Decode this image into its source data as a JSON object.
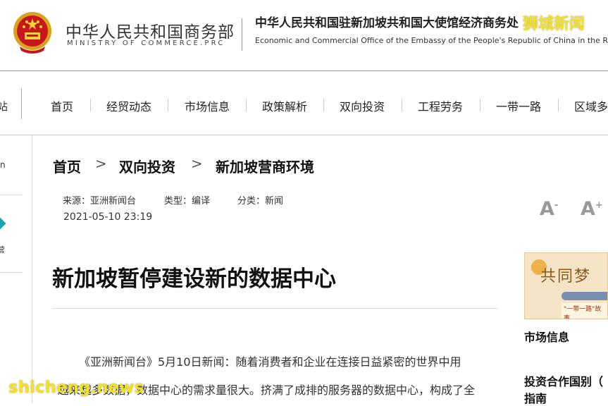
{
  "header": {
    "ministry_cn": "中华人民共和国商务部",
    "ministry_en": "MINISTRY OF COMMERCE.PRC",
    "office_cn": "中华人民共和国驻新加坡共和国大使馆经济商务处",
    "office_en": "Economic and Commercial Office of the Embassy of the People's Republic of China in the Rep",
    "watermark": "狮城新闻"
  },
  "nav": {
    "cut_item": "站",
    "items": [
      "首页",
      "经贸动态",
      "市场信息",
      "政策解析",
      "双向投资",
      "工程劳务",
      "一带一路",
      "区域多"
    ]
  },
  "sidebar": {
    "cut_n": "n",
    "cut_ying": "营"
  },
  "breadcrumb": {
    "items": [
      "首页",
      "双向投资",
      "新加坡营商环境"
    ],
    "separator": ">"
  },
  "meta": {
    "source": "来源：亚洲新闻台",
    "type": "类型：编译",
    "category": "分类：新闻",
    "date": "2021-05-10 23:19"
  },
  "font_controls": {
    "decrease": "A",
    "decrease_sign": "-",
    "increase": "A",
    "increase_sign": "+"
  },
  "article": {
    "title": "新加坡暂停建设新的数据中心",
    "para1": "《亚洲新闻台》5月10日新闻：随着消费者和企业在连接日益紧密的世界中用",
    "para2": "越来越多数据，数据中心的需求量很大。挤满了成排的服务器的数据中心，构成了全"
  },
  "right": {
    "banner_text": "共同梦",
    "banner_sub": "\"一带一路\"故事",
    "heading1": "市场信息",
    "heading2": "投资合作国别（",
    "heading3": "指南"
  },
  "footer_watermark": "shicheng.news",
  "colors": {
    "accent": "#c8161d",
    "watermark": "#f4e21f",
    "teal": "#1aa3b3"
  }
}
